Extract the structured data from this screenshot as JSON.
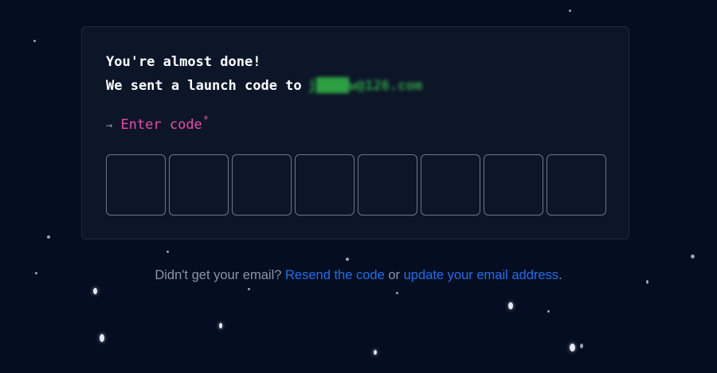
{
  "card": {
    "line1": "You're almost done!",
    "line2_prefix": "We sent a launch code to",
    "email": "j████w@126.com",
    "prompt_arrow": "→",
    "prompt_label": "Enter code",
    "required_mark": "*",
    "code_inputs": [
      "",
      "",
      "",
      "",
      "",
      "",
      "",
      ""
    ]
  },
  "footer": {
    "prefix": "Didn't get your email? ",
    "resend_link": "Resend the code",
    "middle": " or ",
    "update_link": "update your email address",
    "suffix": "."
  },
  "colors": {
    "background": "#040d21",
    "card": "#0d1629",
    "accent_pink": "#ea4aaa",
    "email_green": "#2ea043",
    "link_blue": "#1f6feb"
  }
}
